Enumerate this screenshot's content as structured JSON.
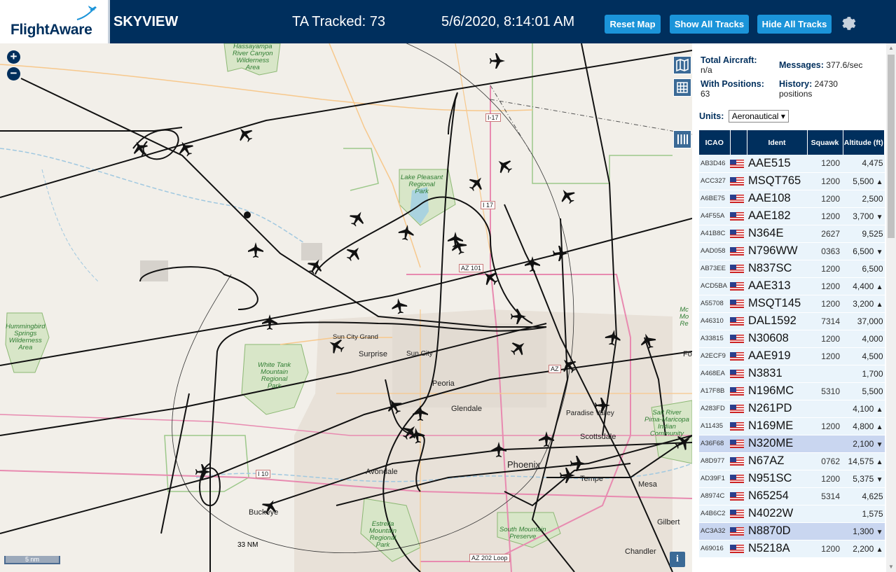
{
  "header": {
    "logo_text": "FlightAware",
    "app_title": "SKYVIEW",
    "tracked": "TA Tracked: 73",
    "datetime": "5/6/2020, 8:14:01 AM",
    "reset_label": "Reset Map",
    "show_label": "Show All Tracks",
    "hide_label": "Hide All Tracks",
    "settings_icon": "gear-icon"
  },
  "map": {
    "labels": {
      "hassayampa": "Hassayampa\nRiver Canyon\nWilderness\nArea",
      "hummingbird": "Hummingbird\nSprings\nWilderness\nArea",
      "white_tank": "White Tank\nMountain\nRegional\nPark",
      "lake_pleasant": "Lake Pleasant\nRegional\nPark",
      "estrella": "Estrella\nMountain\nRegional\nPark",
      "south_mountain": "South Mountain\nPreserve",
      "salt_river": "Salt River\nPima-Maricopa\nIndian\nCommunity",
      "sun_city_grand": "Sun City Grand",
      "surprise": "Surprise",
      "sun_city": "Sun City",
      "peoria": "Peoria",
      "glendale": "Glendale",
      "paradise_valley": "Paradise Valley",
      "scottsdale": "Scottsdale",
      "phoenix": "Phoenix",
      "tempe": "Tempe",
      "mesa": "Mesa",
      "avondale": "Avondale",
      "buckeye": "Buckeye",
      "chandler": "Chandler",
      "gilbert": "Gilbert",
      "i17_a": "I-17",
      "i17_b": "I 17",
      "az101": "AZ 101",
      "i10": "I 10",
      "az202": "AZ 202 Loop",
      "az_small": "AZ",
      "mc": "Mc\nMo\nRe",
      "fo": "Fo"
    },
    "range_label": "33 NM",
    "scale_label": "5 nm",
    "info_label": "i"
  },
  "panel": {
    "total_aircraft_label": "Total Aircraft:",
    "total_aircraft_value": "n/a",
    "with_positions_label": "With Positions:",
    "with_positions_value": "63",
    "messages_label": "Messages:",
    "messages_value": "377.6/sec",
    "history_label": "History:",
    "history_value": "24730",
    "history_unit": "positions",
    "units_label": "Units:",
    "units_value": "Aeronautical",
    "columns": [
      "ICAO",
      "Ident",
      "Squawk",
      "Altitude (ft)"
    ],
    "rows": [
      {
        "icao": "AB3D46",
        "ident": "AAE515",
        "squawk": "1200",
        "alt": "4,475",
        "trend": ""
      },
      {
        "icao": "ACC327",
        "ident": "MSQT765",
        "squawk": "1200",
        "alt": "5,500",
        "trend": "▲"
      },
      {
        "icao": "A6BE75",
        "ident": "AAE108",
        "squawk": "1200",
        "alt": "2,500",
        "trend": ""
      },
      {
        "icao": "A4F55A",
        "ident": "AAE182",
        "squawk": "1200",
        "alt": "3,700",
        "trend": "▼"
      },
      {
        "icao": "A41B8C",
        "ident": "N364E",
        "squawk": "2627",
        "alt": "9,525",
        "trend": ""
      },
      {
        "icao": "AAD058",
        "ident": "N796WW",
        "squawk": "0363",
        "alt": "6,500",
        "trend": "▼"
      },
      {
        "icao": "AB73EE",
        "ident": "N837SC",
        "squawk": "1200",
        "alt": "6,500",
        "trend": ""
      },
      {
        "icao": "ACD5BA",
        "ident": "AAE313",
        "squawk": "1200",
        "alt": "4,400",
        "trend": "▲"
      },
      {
        "icao": "A55708",
        "ident": "MSQT145",
        "squawk": "1200",
        "alt": "3,200",
        "trend": "▲"
      },
      {
        "icao": "A46310",
        "ident": "DAL1592",
        "squawk": "7314",
        "alt": "37,000",
        "trend": ""
      },
      {
        "icao": "A33815",
        "ident": "N30608",
        "squawk": "1200",
        "alt": "4,000",
        "trend": ""
      },
      {
        "icao": "A2ECF9",
        "ident": "AAE919",
        "squawk": "1200",
        "alt": "4,500",
        "trend": ""
      },
      {
        "icao": "A468EA",
        "ident": "N3831",
        "squawk": "",
        "alt": "1,700",
        "trend": ""
      },
      {
        "icao": "A17F8B",
        "ident": "N196MC",
        "squawk": "5310",
        "alt": "5,500",
        "trend": ""
      },
      {
        "icao": "A283FD",
        "ident": "N261PD",
        "squawk": "",
        "alt": "4,100",
        "trend": "▲"
      },
      {
        "icao": "A11435",
        "ident": "N169ME",
        "squawk": "1200",
        "alt": "4,800",
        "trend": "▲"
      },
      {
        "icao": "A36F68",
        "ident": "N320ME",
        "squawk": "",
        "alt": "2,100",
        "trend": "▼"
      },
      {
        "icao": "A8D977",
        "ident": "N67AZ",
        "squawk": "0762",
        "alt": "14,575",
        "trend": "▲"
      },
      {
        "icao": "AD39F1",
        "ident": "N951SC",
        "squawk": "1200",
        "alt": "5,375",
        "trend": "▼"
      },
      {
        "icao": "A8974C",
        "ident": "N65254",
        "squawk": "5314",
        "alt": "4,625",
        "trend": ""
      },
      {
        "icao": "A4B6C2",
        "ident": "N4022W",
        "squawk": "",
        "alt": "1,575",
        "trend": ""
      },
      {
        "icao": "AC3A32",
        "ident": "N8870D",
        "squawk": "",
        "alt": "1,300",
        "trend": "▼"
      },
      {
        "icao": "A69016",
        "ident": "N5218A",
        "squawk": "1200",
        "alt": "2,200",
        "trend": "▲"
      }
    ]
  },
  "colors": {
    "header_bg": "#002f5d",
    "button_bg": "#1b94d9",
    "row_bg": "#eaf4fb",
    "selected_row_bg": "#c9d6f0"
  }
}
